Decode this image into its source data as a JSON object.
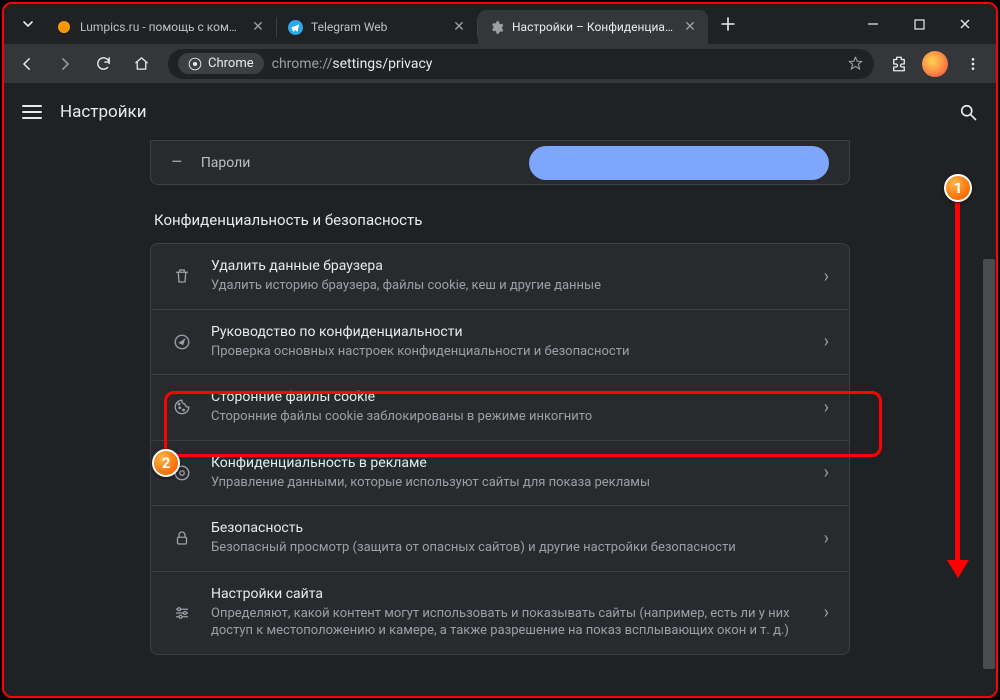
{
  "tabs": [
    {
      "title": "Lumpics.ru - помощь с компью",
      "favicon": "orange-dot"
    },
    {
      "title": "Telegram Web",
      "favicon": "telegram"
    },
    {
      "title": "Настройки – Конфиденциаль",
      "favicon": "gear",
      "active": true
    }
  ],
  "toolbar": {
    "chip_label": "Chrome",
    "url_prefix": "chrome://",
    "url_path": "settings/privacy"
  },
  "settings": {
    "header": "Настройки",
    "passwords_label": "Пароли",
    "section_title": "Конфиденциальность и безопасность",
    "rows": [
      {
        "title": "Удалить данные браузера",
        "sub": "Удалить историю браузера, файлы cookie, кеш и другие данные",
        "icon": "trash"
      },
      {
        "title": "Руководство по конфиденциальности",
        "sub": "Проверка основных настроек конфиденциальности и безопасности",
        "icon": "compass"
      },
      {
        "title": "Сторонние файлы cookie",
        "sub": "Сторонние файлы cookie заблокированы в режиме инкогнито",
        "icon": "cookie"
      },
      {
        "title": "Конфиденциальность в рекламе",
        "sub": "Управление данными, которые используют сайты для показа рекламы",
        "icon": "ads"
      },
      {
        "title": "Безопасность",
        "sub": "Безопасный просмотр (защита от опасных сайтов) и другие настройки безопасности",
        "icon": "lock"
      },
      {
        "title": "Настройки сайта",
        "sub": "Определяют, какой контент могут использовать и показывать сайты (например, есть ли у них доступ к местоположению и камере, а также разрешение на показ всплывающих окон и т. д.)",
        "icon": "sliders"
      }
    ]
  },
  "annotations": {
    "badge1": "1",
    "badge2": "2"
  }
}
